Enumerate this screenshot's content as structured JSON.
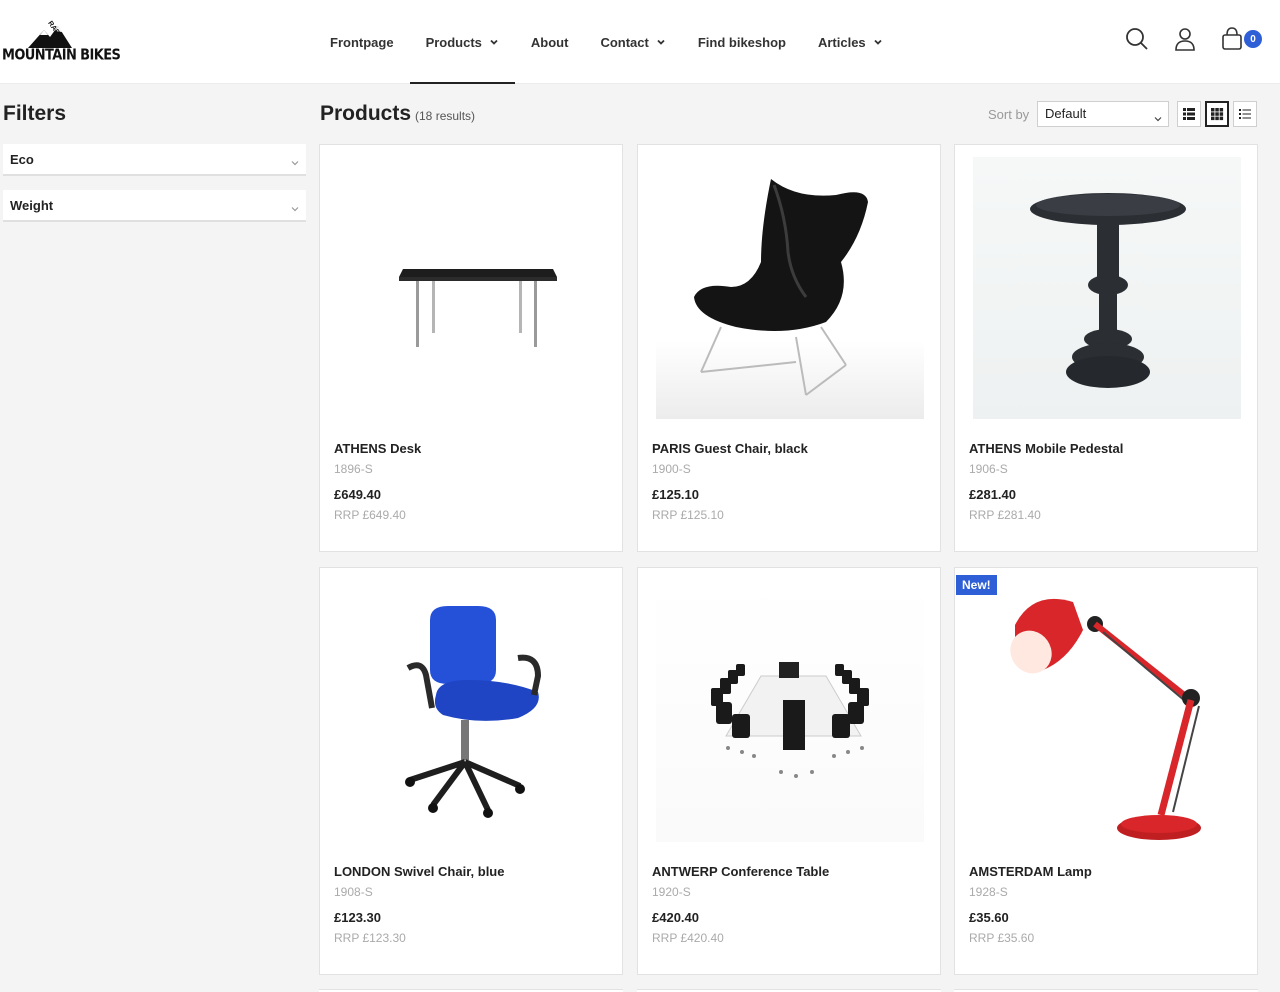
{
  "header": {
    "logo_text": "MOUNTAIN BIKES",
    "logo_tag": "RAPIDO",
    "nav": [
      {
        "label": "Frontpage",
        "has_dropdown": false,
        "active": false
      },
      {
        "label": "Products",
        "has_dropdown": true,
        "active": true
      },
      {
        "label": "About",
        "has_dropdown": false,
        "active": false
      },
      {
        "label": "Contact",
        "has_dropdown": true,
        "active": false
      },
      {
        "label": "Find bikeshop",
        "has_dropdown": false,
        "active": false
      },
      {
        "label": "Articles",
        "has_dropdown": true,
        "active": false
      }
    ],
    "cart_count": "0",
    "icons": [
      "search-icon",
      "user-icon",
      "cart-icon"
    ]
  },
  "sidebar": {
    "title": "Filters",
    "filters": [
      {
        "label": "Eco"
      },
      {
        "label": "Weight"
      }
    ]
  },
  "main": {
    "title": "Products",
    "count_text": "(18 results)",
    "sort_label": "Sort by",
    "sort_value": "Default",
    "view_modes": [
      "list-large-icon",
      "grid-icon",
      "list-icon"
    ],
    "active_view": "grid-icon"
  },
  "products": [
    {
      "name": "ATHENS Desk",
      "sku": "1896-S",
      "price": "£649.40",
      "rrp": "RRP £649.40",
      "badge": ""
    },
    {
      "name": "PARIS Guest Chair, black",
      "sku": "1900-S",
      "price": "£125.10",
      "rrp": "RRP £125.10",
      "badge": ""
    },
    {
      "name": "ATHENS Mobile Pedestal",
      "sku": "1906-S",
      "price": "£281.40",
      "rrp": "RRP £281.40",
      "badge": ""
    },
    {
      "name": "LONDON Swivel Chair, blue",
      "sku": "1908-S",
      "price": "£123.30",
      "rrp": "RRP £123.30",
      "badge": ""
    },
    {
      "name": "ANTWERP Conference Table",
      "sku": "1920-S",
      "price": "£420.40",
      "rrp": "RRP £420.40",
      "badge": ""
    },
    {
      "name": "AMSTERDAM Lamp",
      "sku": "1928-S",
      "price": "£35.60",
      "rrp": "RRP £35.60",
      "badge": "New!"
    }
  ],
  "colors": {
    "accent": "#2f5fd6",
    "lamp_red": "#d8262a",
    "chair_blue": "#2550d8"
  }
}
